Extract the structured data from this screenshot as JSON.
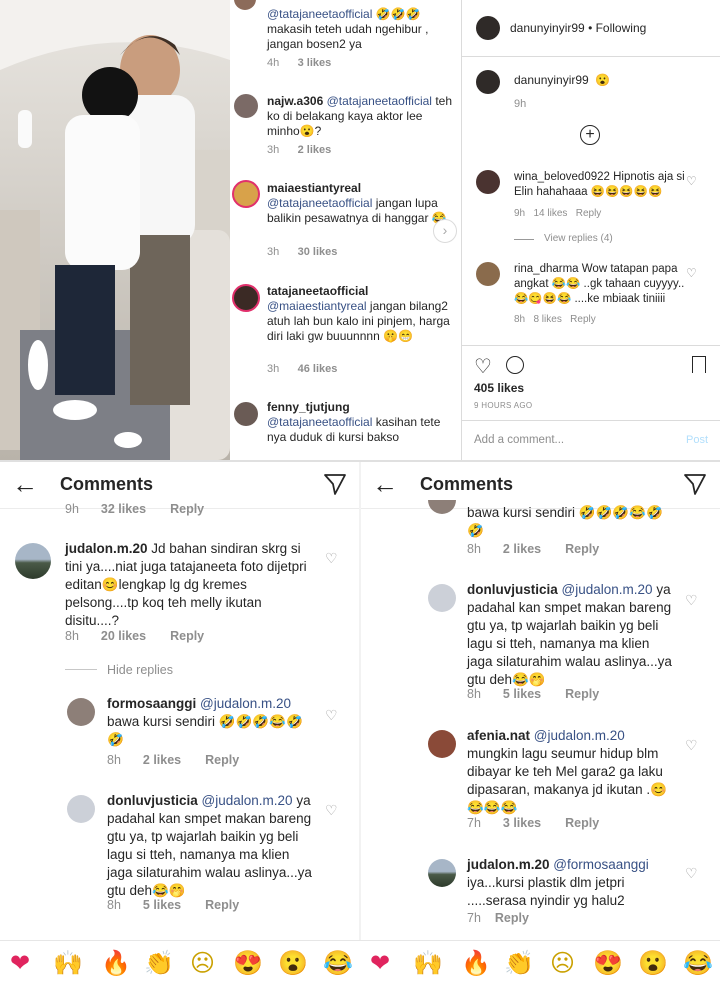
{
  "post_author": "danunyinyir99",
  "following_label": "• Following",
  "caption": {
    "user": "danunyinyir99",
    "emoji": "😮",
    "time": "9h"
  },
  "likes_count": "405 likes",
  "post_time": "9 HOURS AGO",
  "add_comment_placeholder": "Add a comment...",
  "post_button": "Post",
  "middle_comments": [
    {
      "user": "@tatajaneetaofficial",
      "text": "🤣🤣🤣 makasih teteh udah ngehibur , jangan bosen2 ya",
      "time": "4h",
      "likes": "3 likes"
    },
    {
      "user": "najw.a306",
      "mention": "@tatajaneetaofficial",
      "text": "teh ko di belakang kaya aktor lee minho😮?",
      "time": "3h",
      "likes": "2 likes"
    },
    {
      "user": "maiaestiantyreal",
      "mention": "@tatajaneetaofficial",
      "text": "jangan lupa balikin pesawatnya di hanggar 😂",
      "time": "3h",
      "likes": "30 likes"
    },
    {
      "user": "tatajaneetaofficial",
      "mention": "@maiaestiantyreal",
      "text": "jangan bilang2 atuh lah bun kalo ini pinjem, harga diri laki gw buuunnnn 🤫😁",
      "time": "3h",
      "likes": "46 likes"
    },
    {
      "user": "fenny_tjutjung",
      "mention": "@tatajaneetaofficial",
      "text": "kasihan tete nya duduk di kursi bakso"
    }
  ],
  "right_comments": [
    {
      "user": "wina_beloved0922",
      "text": "Hipnotis aja si Elin hahahaaa 😆😆😆😆😆",
      "time": "9h",
      "likes": "14 likes",
      "reply": "Reply",
      "view_replies": "View replies (4)"
    },
    {
      "user": "rina_dharma",
      "text": "Wow tatapan papa angkat 😂😂 ..gk tahaan cuyyyy..😂😋😆😂 ....ke mbiaak tiniiii",
      "time": "8h",
      "likes": "8 likes",
      "reply": "Reply"
    }
  ],
  "screen_left": {
    "title": "Comments",
    "top_partial": {
      "time": "9h",
      "likes": "32 likes",
      "reply": "Reply"
    },
    "comments": [
      {
        "user": "judalon.m.20",
        "text": "Jd bahan sindiran skrg si tini ya....niat juga tatajaneeta foto dijetpri editan😊lengkap lg dg kremes pelsong....tp koq teh melly ikutan disitu....?",
        "time": "8h",
        "likes": "20 likes",
        "reply": "Reply"
      },
      {
        "user": "formosaanggi",
        "mention": "@judalon.m.20",
        "text": "bawa  kursi sendiri 🤣🤣🤣😂🤣🤣",
        "time": "8h",
        "likes": "2 likes",
        "reply": "Reply"
      },
      {
        "user": "donluvjusticia",
        "mention": "@judalon.m.20",
        "text": "ya padahal kan smpet makan bareng gtu ya, tp wajarlah baikin yg beli lagu si tteh, namanya ma klien jaga silaturahim walau aslinya...ya gtu deh😂🤭",
        "time": "8h",
        "likes": "5 likes",
        "reply": "Reply"
      }
    ],
    "hide_replies": "Hide replies"
  },
  "screen_right": {
    "title": "Comments",
    "top_partial": {
      "text": "bawa  kursi sendiri 🤣🤣🤣😂🤣🤣",
      "time": "8h",
      "likes": "2 likes",
      "reply": "Reply"
    },
    "comments": [
      {
        "user": "donluvjusticia",
        "mention": "@judalon.m.20",
        "text": "ya padahal kan smpet makan bareng gtu ya, tp wajarlah baikin yg beli lagu si tteh, namanya ma klien jaga silaturahim walau aslinya...ya gtu deh😂🤭",
        "time": "8h",
        "likes": "5 likes",
        "reply": "Reply"
      },
      {
        "user": "afenia.nat",
        "mention": "@judalon.m.20",
        "text": "mungkin lagu seumur hidup blm dibayar ke teh Mel gara2 ga laku dipasaran, makanya jd ikutan .😊😂😂😂",
        "time": "7h",
        "likes": "3 likes",
        "reply": "Reply"
      },
      {
        "user": "judalon.m.20",
        "mention": "@formosaanggi",
        "text": "iya...kursi plastik dlm jetpri .....serasa nyindir yg halu2",
        "time": "7h",
        "reply": "Reply"
      }
    ]
  },
  "emojis": [
    "❤",
    "🙌",
    "🔥",
    "👏",
    "☹",
    "😍",
    "😮",
    "😂"
  ]
}
